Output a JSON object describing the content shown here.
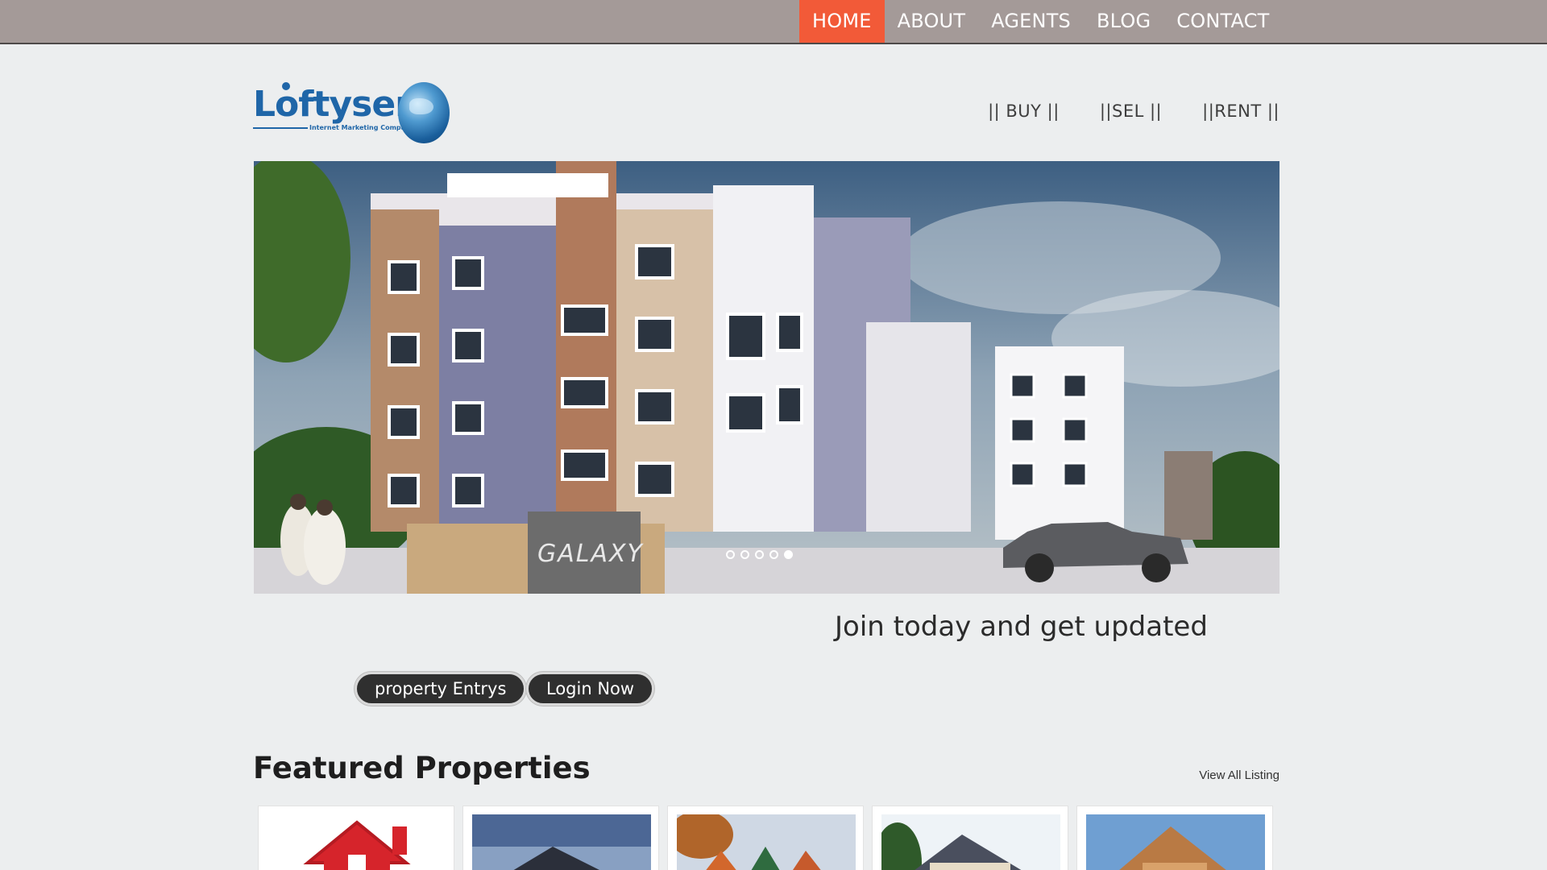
{
  "topnav": {
    "items": [
      {
        "label": "HOME",
        "active": true
      },
      {
        "label": "ABOUT"
      },
      {
        "label": "AGENTS"
      },
      {
        "label": "BLOG"
      },
      {
        "label": "CONTACT"
      }
    ]
  },
  "logo": {
    "name": "Loftyserp",
    "tagline": "Internet Marketing Company"
  },
  "subnav": {
    "items": [
      {
        "label": "|| BUY ||"
      },
      {
        "label": "||SEL ||"
      },
      {
        "label": "||RENT ||"
      }
    ]
  },
  "hero": {
    "sign_text": "GALAXY",
    "slides": 5,
    "active_slide": 5
  },
  "cta": {
    "headline": "Join today and get updated",
    "property_button": "property Entrys",
    "login_button": "Login Now"
  },
  "featured": {
    "title": "Featured Properties",
    "view_all": "View All Listing",
    "cards": [
      {
        "icon": "red-house-icon"
      },
      {
        "icon": "dusk-house-photo"
      },
      {
        "icon": "dutch-houses-photo"
      },
      {
        "icon": "suburban-house-photo"
      },
      {
        "icon": "cottage-house-photo"
      }
    ]
  },
  "colors": {
    "topbar": "#a49a98",
    "active_nav": "#f25a38",
    "brand_blue": "#1f66a8",
    "button_dark": "#2f2f2f"
  }
}
